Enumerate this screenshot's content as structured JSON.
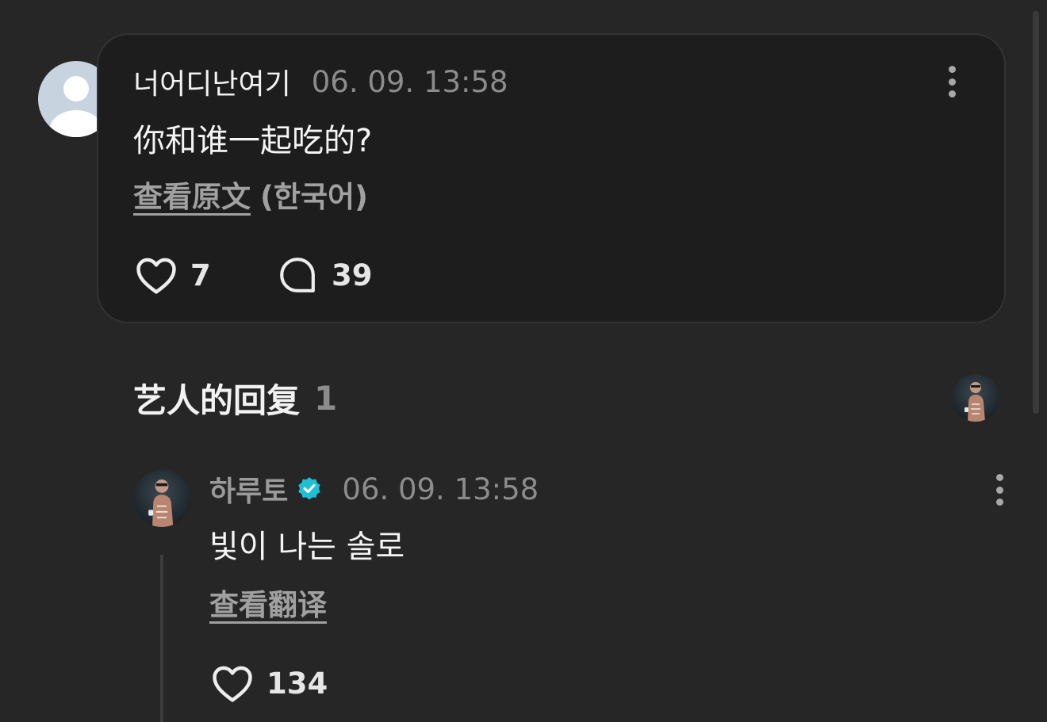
{
  "comment": {
    "author": "너어디난여기",
    "timestamp": "06. 09. 13:58",
    "text": "你和谁一起吃的?",
    "view_original_label": "查看原文",
    "original_language": "(한국어)",
    "like_count": "7",
    "reply_count": "39"
  },
  "artist_replies": {
    "title": "艺人的回复",
    "count": "1"
  },
  "reply": {
    "author": "하루토",
    "verified": true,
    "timestamp": "06. 09. 13:58",
    "text": "빛이 나는 솔로",
    "view_translation_label": "查看翻译",
    "like_count": "134"
  },
  "colors": {
    "background": "#262626",
    "card": "#1d1d1d",
    "verified_badge": "#1fbfd6",
    "muted_text": "#8c8c8c"
  },
  "icons": {
    "like": "heart-outline-icon",
    "reply": "speech-bubble-icon",
    "more": "more-vertical-icon",
    "verified": "verified-badge-icon"
  }
}
